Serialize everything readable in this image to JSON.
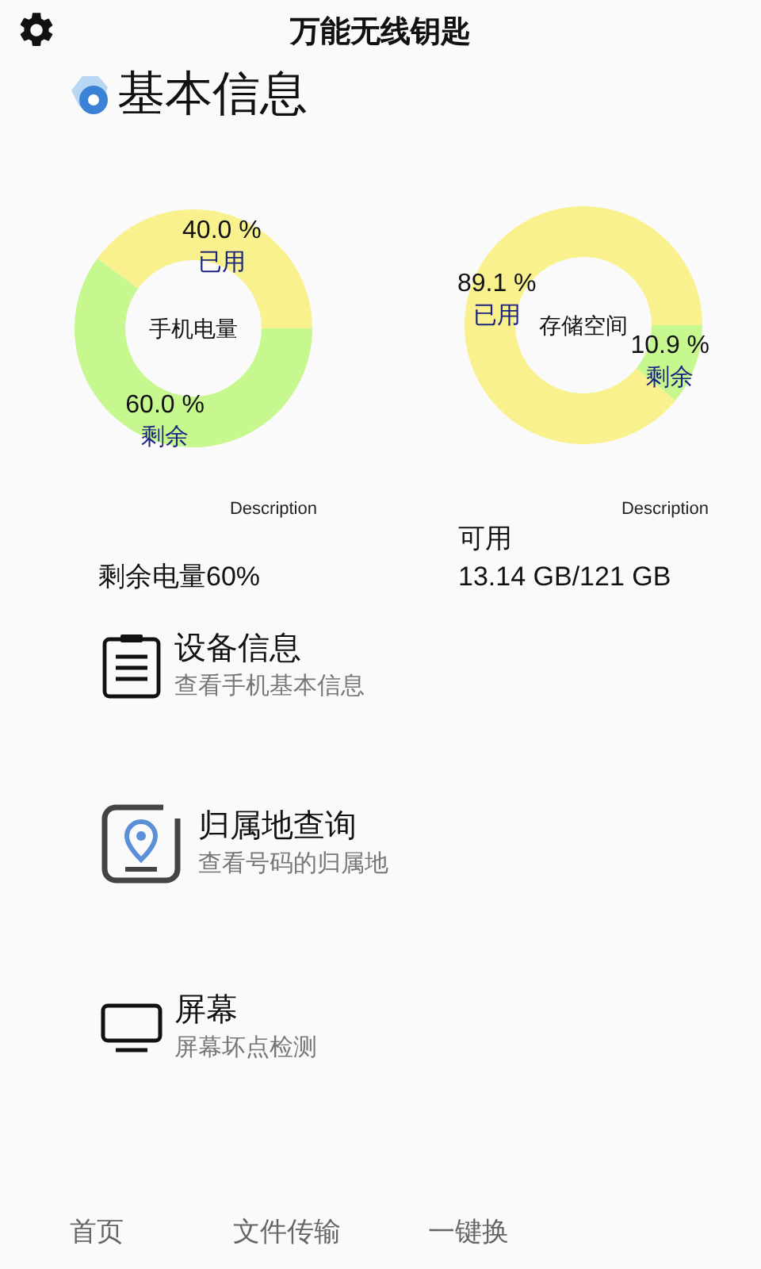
{
  "app_bar": {
    "title": "万能无线钥匙"
  },
  "section": {
    "title": "基本信息"
  },
  "charts": [
    {
      "chart_data": {
        "type": "donut",
        "title": "手机电量",
        "categories": [
          "已用",
          "剩余"
        ],
        "values": [
          40.0,
          60.0
        ],
        "colors": [
          "#f9f18e",
          "#c6f88f"
        ],
        "value_labels": [
          "40.0 %",
          "60.0 %"
        ]
      },
      "description": "Description",
      "caption": [
        "剩余电量60%"
      ]
    },
    {
      "chart_data": {
        "type": "donut",
        "title": "存储空间",
        "categories": [
          "已用",
          "剩余"
        ],
        "values": [
          89.1,
          10.9
        ],
        "colors": [
          "#f9f18e",
          "#c6f88f"
        ],
        "value_labels": [
          "89.1 %",
          "10.9 %"
        ]
      },
      "description": "Description",
      "caption": [
        "可用",
        "13.14 GB/121 GB"
      ]
    }
  ],
  "menu": [
    {
      "kind": "device",
      "title": "设备信息",
      "subtitle": "查看手机基本信息"
    },
    {
      "kind": "location",
      "title": "归属地查询",
      "subtitle": "查看号码的归属地"
    },
    {
      "kind": "screen",
      "title": "屏幕",
      "subtitle": "屏幕坏点检测"
    }
  ],
  "bottom_nav": [
    {
      "label": "首页"
    },
    {
      "label": "文件传输"
    },
    {
      "label": "一键换"
    }
  ]
}
